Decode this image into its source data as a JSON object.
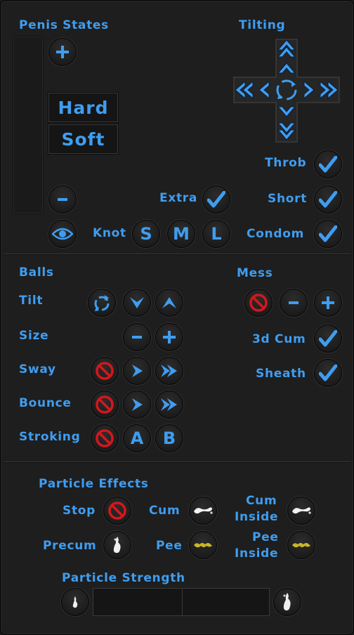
{
  "penis_states": {
    "title": "Penis States",
    "states": [
      "Hard",
      "Soft"
    ],
    "add_label": "+",
    "remove_label": "-"
  },
  "tilting": {
    "title": "Tilting"
  },
  "toggles": {
    "throb": "Throb",
    "extra": "Extra",
    "short": "Short",
    "condom": "Condom"
  },
  "knot": {
    "label": "Knot",
    "sizes": [
      "S",
      "M",
      "L"
    ]
  },
  "balls": {
    "title": "Balls",
    "tilt": "Tilt",
    "size": "Size",
    "sway": "Sway",
    "bounce": "Bounce",
    "stroking": "Stroking",
    "stroking_modes": [
      "A",
      "B"
    ]
  },
  "mess": {
    "title": "Mess",
    "cum3d": "3d Cum",
    "sheath": "Sheath"
  },
  "particles": {
    "title": "Particle Effects",
    "stop": "Stop",
    "cum": "Cum",
    "cum_inside": [
      "Cum",
      "Inside"
    ],
    "precum": "Precum",
    "pee": "Pee",
    "pee_inside": [
      "Pee",
      "Inside"
    ],
    "strength_title": "Particle Strength"
  },
  "colors": {
    "accent": "#3f9df0",
    "stop_red": "#d6161c",
    "pee_yellow": "#c9b628"
  },
  "icons": [
    "plus-icon",
    "minus-icon",
    "eye-icon",
    "check-icon",
    "recycle-icon",
    "arrow-up-icon",
    "arrow-down-icon",
    "arrow-left-icon",
    "arrow-right-icon",
    "double-arrow-icon",
    "stop-icon",
    "drip-icon",
    "splash-icon"
  ]
}
